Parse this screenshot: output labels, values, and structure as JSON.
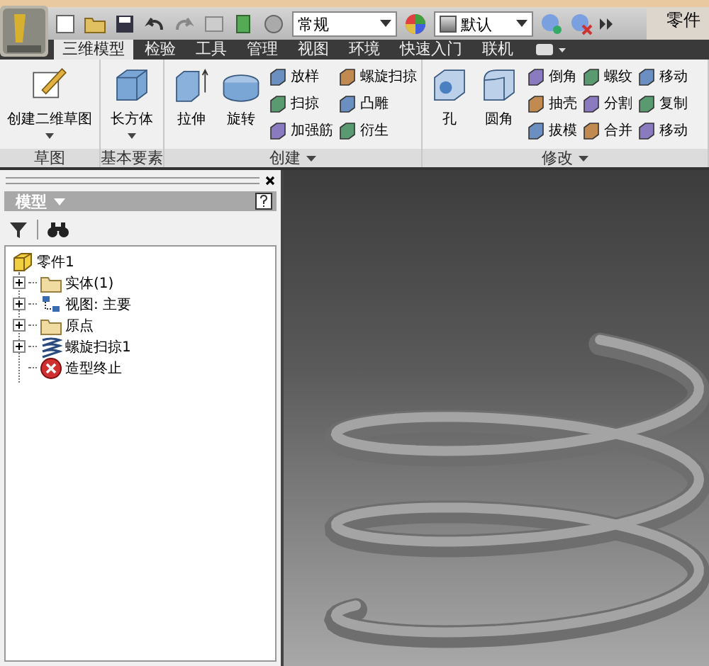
{
  "window": {
    "title": "零件"
  },
  "quick_access": {
    "combos": [
      {
        "value": "常规"
      },
      {
        "value": "默认"
      }
    ]
  },
  "tabs": [
    {
      "label": "三维模型",
      "selected": true
    },
    {
      "label": "检验",
      "selected": false
    },
    {
      "label": "工具",
      "selected": false
    },
    {
      "label": "管理",
      "selected": false
    },
    {
      "label": "视图",
      "selected": false
    },
    {
      "label": "环境",
      "selected": false
    },
    {
      "label": "快速入门",
      "selected": false
    },
    {
      "label": "联机",
      "selected": false
    }
  ],
  "ribbon": [
    {
      "label": "草图",
      "has_menu": false,
      "items": [
        {
          "kind": "large",
          "label": "创建二维草图",
          "has_menu": true
        }
      ]
    },
    {
      "label": "基本要素",
      "has_menu": false,
      "items": [
        {
          "kind": "large",
          "label": "长方体",
          "has_menu": true
        }
      ]
    },
    {
      "label": "创建",
      "has_menu": true,
      "items": [
        {
          "kind": "large",
          "label": "拉伸",
          "has_menu": false
        },
        {
          "kind": "large",
          "label": "旋转",
          "has_menu": false
        },
        {
          "kind": "column",
          "buttons": [
            "放样",
            "扫掠",
            "加强筋"
          ]
        },
        {
          "kind": "column",
          "buttons": [
            "螺旋扫掠",
            "凸雕",
            "衍生"
          ]
        }
      ]
    },
    {
      "label": "修改",
      "has_menu": true,
      "items": [
        {
          "kind": "large",
          "label": "孔",
          "has_menu": false
        },
        {
          "kind": "large",
          "label": "圆角",
          "has_menu": false
        },
        {
          "kind": "column",
          "buttons": [
            "倒角",
            "抽壳",
            "拔模"
          ]
        },
        {
          "kind": "column",
          "buttons": [
            "螺纹",
            "分割",
            "合并"
          ]
        },
        {
          "kind": "column",
          "buttons": [
            "移动",
            "复制",
            "移动"
          ]
        }
      ]
    }
  ],
  "browser": {
    "title": "模型",
    "tree": {
      "label": "零件1",
      "children": [
        {
          "label": "实体(1)",
          "expandable": true
        },
        {
          "label": "视图: 主要",
          "expandable": true
        },
        {
          "label": "原点",
          "expandable": true
        },
        {
          "label": "螺旋扫掠1",
          "expandable": true
        },
        {
          "label": "造型终止",
          "expandable": false
        }
      ]
    }
  }
}
